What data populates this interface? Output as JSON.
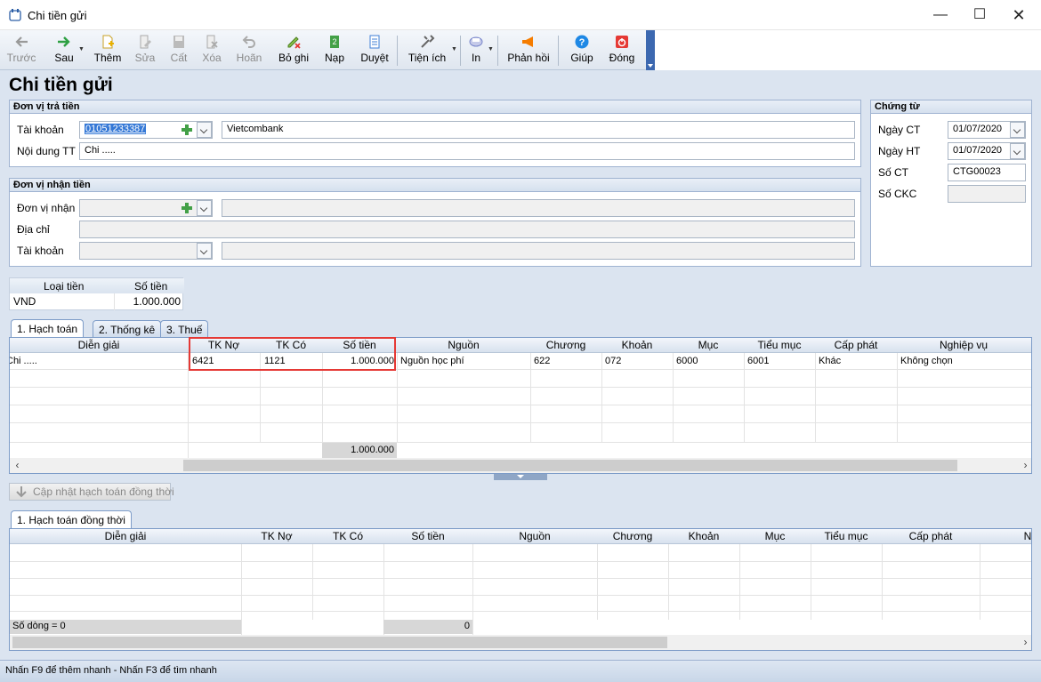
{
  "window": {
    "title": "Chi tiền gửi"
  },
  "toolbar": {
    "back": "Trước",
    "next": "Sau",
    "add": "Thêm",
    "edit": "Sửa",
    "save": "Cất",
    "delete": "Xóa",
    "undo": "Hoãn",
    "unpost": "Bỏ ghi",
    "post": "Nạp",
    "approve": "Duyệt",
    "utilities": "Tiện ích",
    "print": "In",
    "feedback": "Phản hồi",
    "help": "Giúp",
    "close": "Đóng"
  },
  "page": {
    "title": "Chi tiền gửi"
  },
  "payer": {
    "heading": "Đơn vị trả tiền",
    "account_label": "Tài khoản",
    "account_value": "01051233387",
    "bank_name": "Vietcombank",
    "content_label": "Nội dung TT",
    "content_value": "Chi ....."
  },
  "receiver": {
    "heading": "Đơn vị nhận tiền",
    "unit_label": "Đơn vị nhận",
    "address_label": "Địa chỉ",
    "account_label": "Tài khoản"
  },
  "voucher": {
    "heading": "Chứng từ",
    "date_ct_label": "Ngày CT",
    "date_ct": "01/07/2020",
    "date_ht_label": "Ngày HT",
    "date_ht": "01/07/2020",
    "number_label": "Số CT",
    "number": "CTG00023",
    "ckc_label": "Số CKC",
    "ckc": ""
  },
  "currency": {
    "type_label": "Loại tiền",
    "amount_label": "Số tiền",
    "type": "VND",
    "amount": "1.000.000"
  },
  "tabs": {
    "accounting": "1. Hạch toán",
    "stats": "2. Thống kê",
    "tax": "3. Thuế"
  },
  "grid1": {
    "columns": [
      "Diễn giải",
      "TK Nợ",
      "TK Có",
      "Số tiền",
      "Nguồn",
      "Chương",
      "Khoản",
      "Mục",
      "Tiểu mục",
      "Cấp phát",
      "Nghiệp vụ"
    ],
    "row": [
      "Chi .....",
      "6421",
      "1121",
      "1.000.000",
      "Nguồn học phí",
      "622",
      "072",
      "6000",
      "6001",
      "Khác",
      "Không chọn"
    ],
    "total": "1.000.000"
  },
  "update_button": "Cập nhật hạch toán đồng thời",
  "tab2": {
    "label": "1. Hạch toán đồng thời"
  },
  "grid2": {
    "columns": [
      "Diễn giải",
      "TK Nợ",
      "TK Có",
      "Số tiền",
      "Nguồn",
      "Chương",
      "Khoản",
      "Mục",
      "Tiểu mục",
      "Cấp phát",
      "N"
    ],
    "row_count": "Số dòng = 0",
    "total": "0"
  },
  "status": {
    "text": "Nhấn F9 để thêm nhanh - Nhấn F3 để tìm nhanh"
  }
}
